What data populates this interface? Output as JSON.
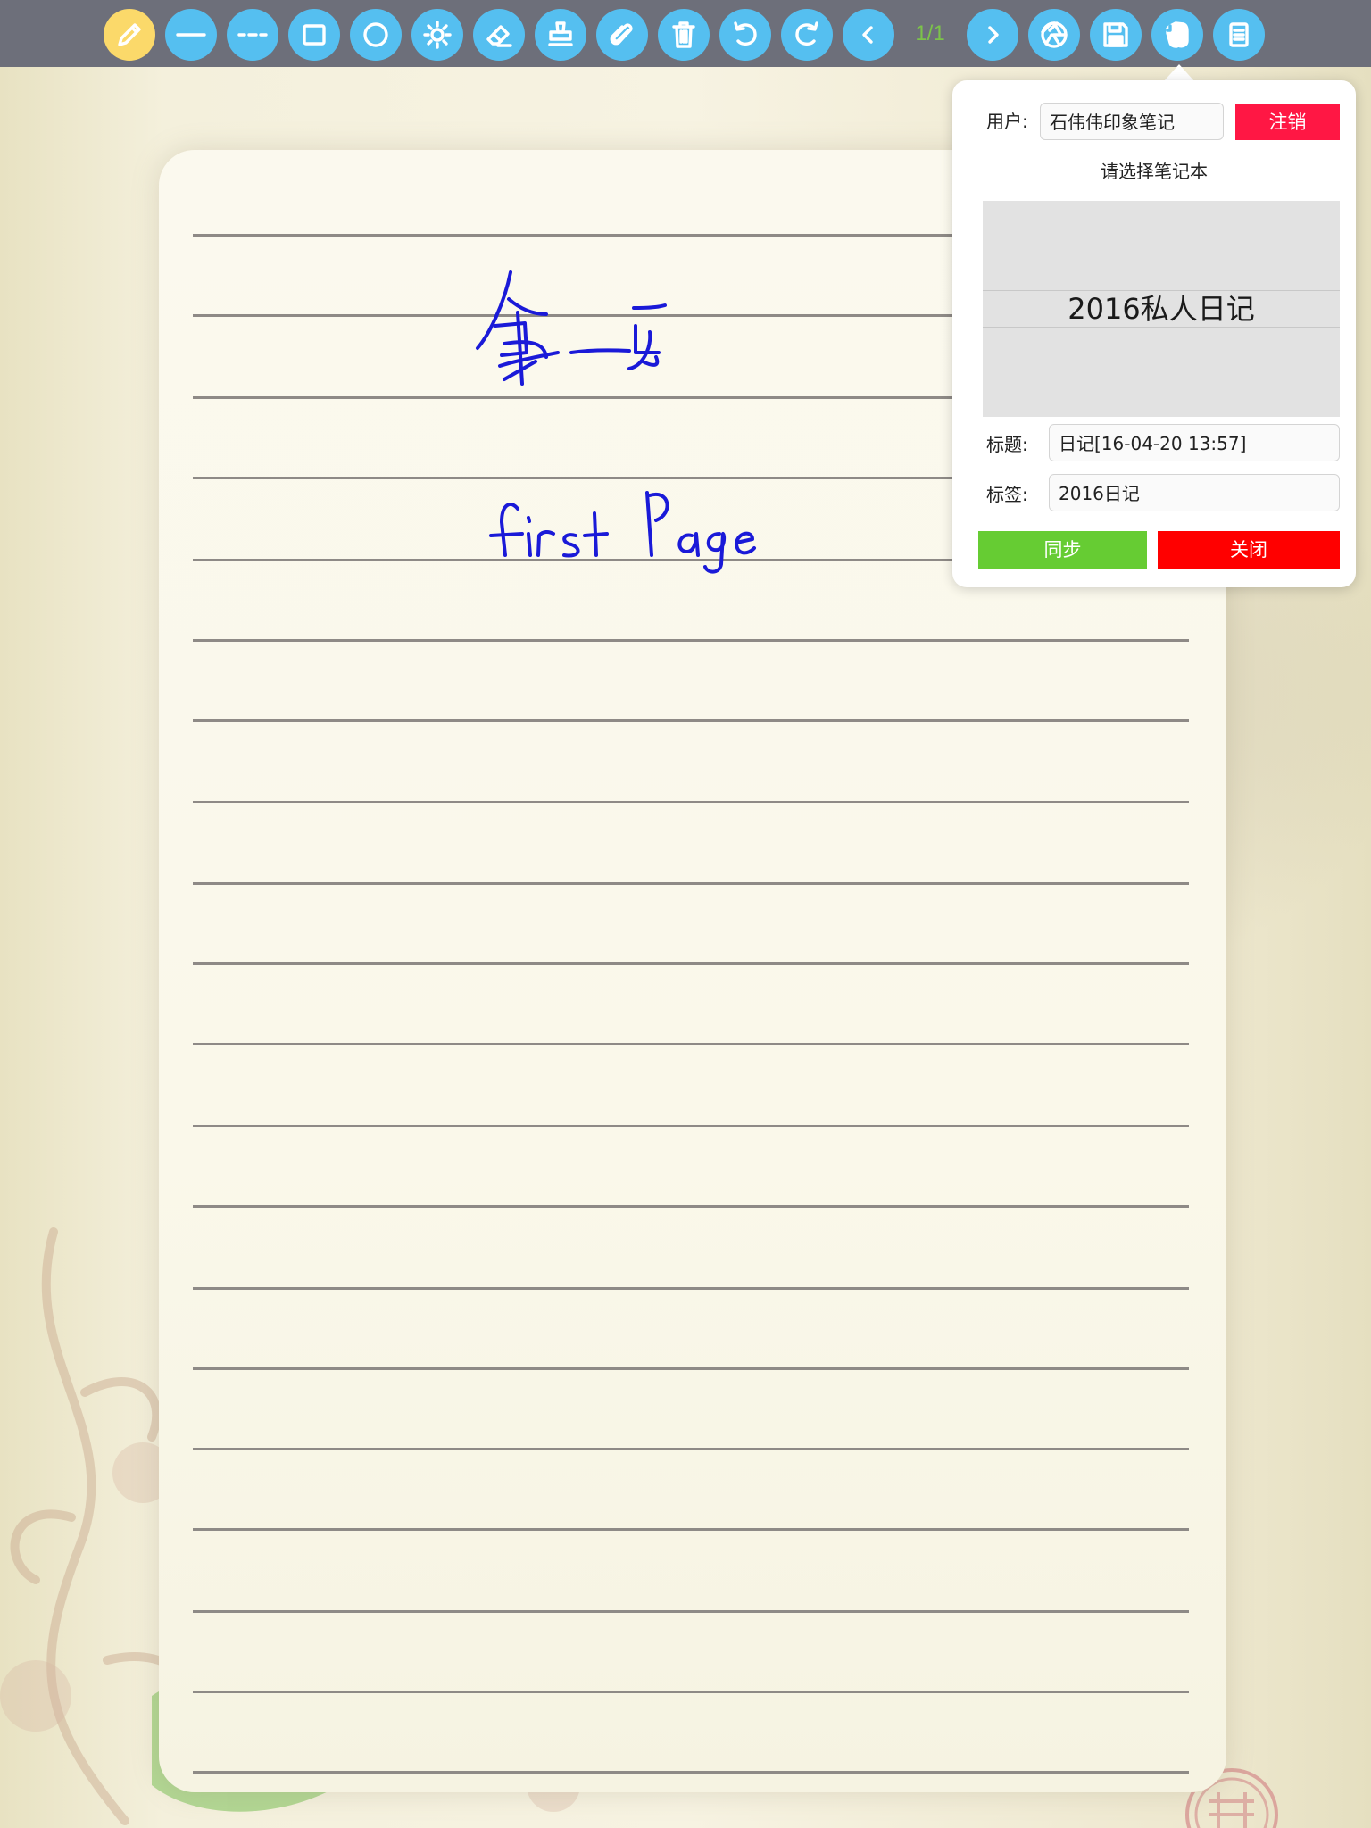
{
  "toolbar": {
    "buttons": [
      {
        "name": "pencil-tool-button",
        "icon": "pencil-icon"
      },
      {
        "name": "solid-line-tool-button",
        "icon": "solid-line-icon"
      },
      {
        "name": "dashed-line-tool-button",
        "icon": "dashed-line-icon"
      },
      {
        "name": "rectangle-tool-button",
        "icon": "rectangle-icon"
      },
      {
        "name": "circle-tool-button",
        "icon": "circle-icon"
      },
      {
        "name": "brightness-button",
        "icon": "sun-icon"
      },
      {
        "name": "eraser-tool-button",
        "icon": "eraser-icon"
      },
      {
        "name": "stamp-tool-button",
        "icon": "stamp-icon"
      },
      {
        "name": "attach-button",
        "icon": "paperclip-icon"
      },
      {
        "name": "delete-button",
        "icon": "trash-icon"
      },
      {
        "name": "undo-button",
        "icon": "undo-icon"
      },
      {
        "name": "redo-button",
        "icon": "redo-icon"
      },
      {
        "name": "prev-page-button",
        "icon": "chevron-left-icon"
      },
      {
        "name": "next-page-button",
        "icon": "chevron-right-icon"
      },
      {
        "name": "camera-button",
        "icon": "aperture-icon"
      },
      {
        "name": "save-button",
        "icon": "floppy-disk-icon"
      },
      {
        "name": "evernote-button",
        "icon": "evernote-elephant-icon"
      },
      {
        "name": "menu-button",
        "icon": "list-icon"
      }
    ],
    "page_indicator": "1/1",
    "colors": {
      "bar": "#6d6f7a",
      "button": "#55bff0",
      "active_button": "#fbd96a",
      "page_indicator": "#7cc34a"
    }
  },
  "popover": {
    "user_label": "用户:",
    "user_value": "石伟伟印象笔记",
    "logout_label": "注销",
    "choose_notebook_label": "请选择笔记本",
    "notebook_options": [
      "2016私人日记"
    ],
    "selected_notebook": "2016私人日记",
    "title_label": "标题:",
    "title_value": "日记[16-04-20 13:57]",
    "tags_label": "标签:",
    "tags_value": "2016日记",
    "sync_label": "同步",
    "close_label": "关闭",
    "colors": {
      "logout": "#ff1744",
      "sync": "#66cc33",
      "close": "#ff0000"
    }
  },
  "page": {
    "handwriting": [
      "第一页",
      "first Page"
    ],
    "ink_color": "#1a1ad8"
  }
}
